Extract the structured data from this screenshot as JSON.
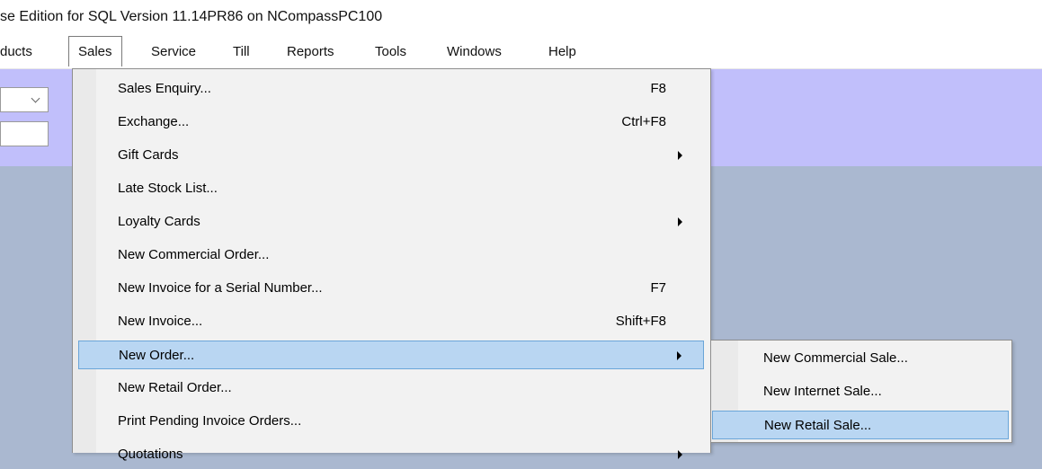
{
  "window": {
    "title": "se Edition for SQL Version 11.14PR86 on NCompassPC100"
  },
  "menubar": {
    "items": [
      {
        "label": "ducts"
      },
      {
        "label": "Sales"
      },
      {
        "label": "Service"
      },
      {
        "label": "Till"
      },
      {
        "label": "Reports"
      },
      {
        "label": "Tools"
      },
      {
        "label": "Windows"
      },
      {
        "label": "Help"
      }
    ],
    "active": "Sales"
  },
  "sales_menu": {
    "items": [
      {
        "label": "Sales Enquiry...",
        "shortcut": "F8"
      },
      {
        "label": "Exchange...",
        "shortcut": "Ctrl+F8"
      },
      {
        "label": "Gift Cards",
        "shortcut": "",
        "submenu": true
      },
      {
        "label": "Late Stock List...",
        "shortcut": ""
      },
      {
        "label": "Loyalty Cards",
        "shortcut": "",
        "submenu": true
      },
      {
        "label": "New Commercial Order...",
        "shortcut": ""
      },
      {
        "label": "New Invoice for a Serial Number...",
        "shortcut": "F7"
      },
      {
        "label": "New Invoice...",
        "shortcut": "Shift+F8"
      },
      {
        "label": "New Order...",
        "shortcut": "",
        "submenu": true,
        "highlighted": true
      },
      {
        "label": "New Retail Order...",
        "shortcut": ""
      },
      {
        "label": "Print Pending Invoice Orders...",
        "shortcut": ""
      },
      {
        "label": "Quotations",
        "shortcut": "",
        "submenu": true
      }
    ]
  },
  "new_order_submenu": {
    "items": [
      {
        "label": "New Commercial Sale..."
      },
      {
        "label": "New Internet Sale..."
      },
      {
        "label": "New Retail Sale...",
        "highlighted": true
      }
    ]
  },
  "colors": {
    "desktop": "#aab8d0",
    "panel": "#c1bffb",
    "menu_bg": "#f2f2f2",
    "highlight": "#b9d6f2",
    "highlight_border": "#6aa5d8"
  }
}
